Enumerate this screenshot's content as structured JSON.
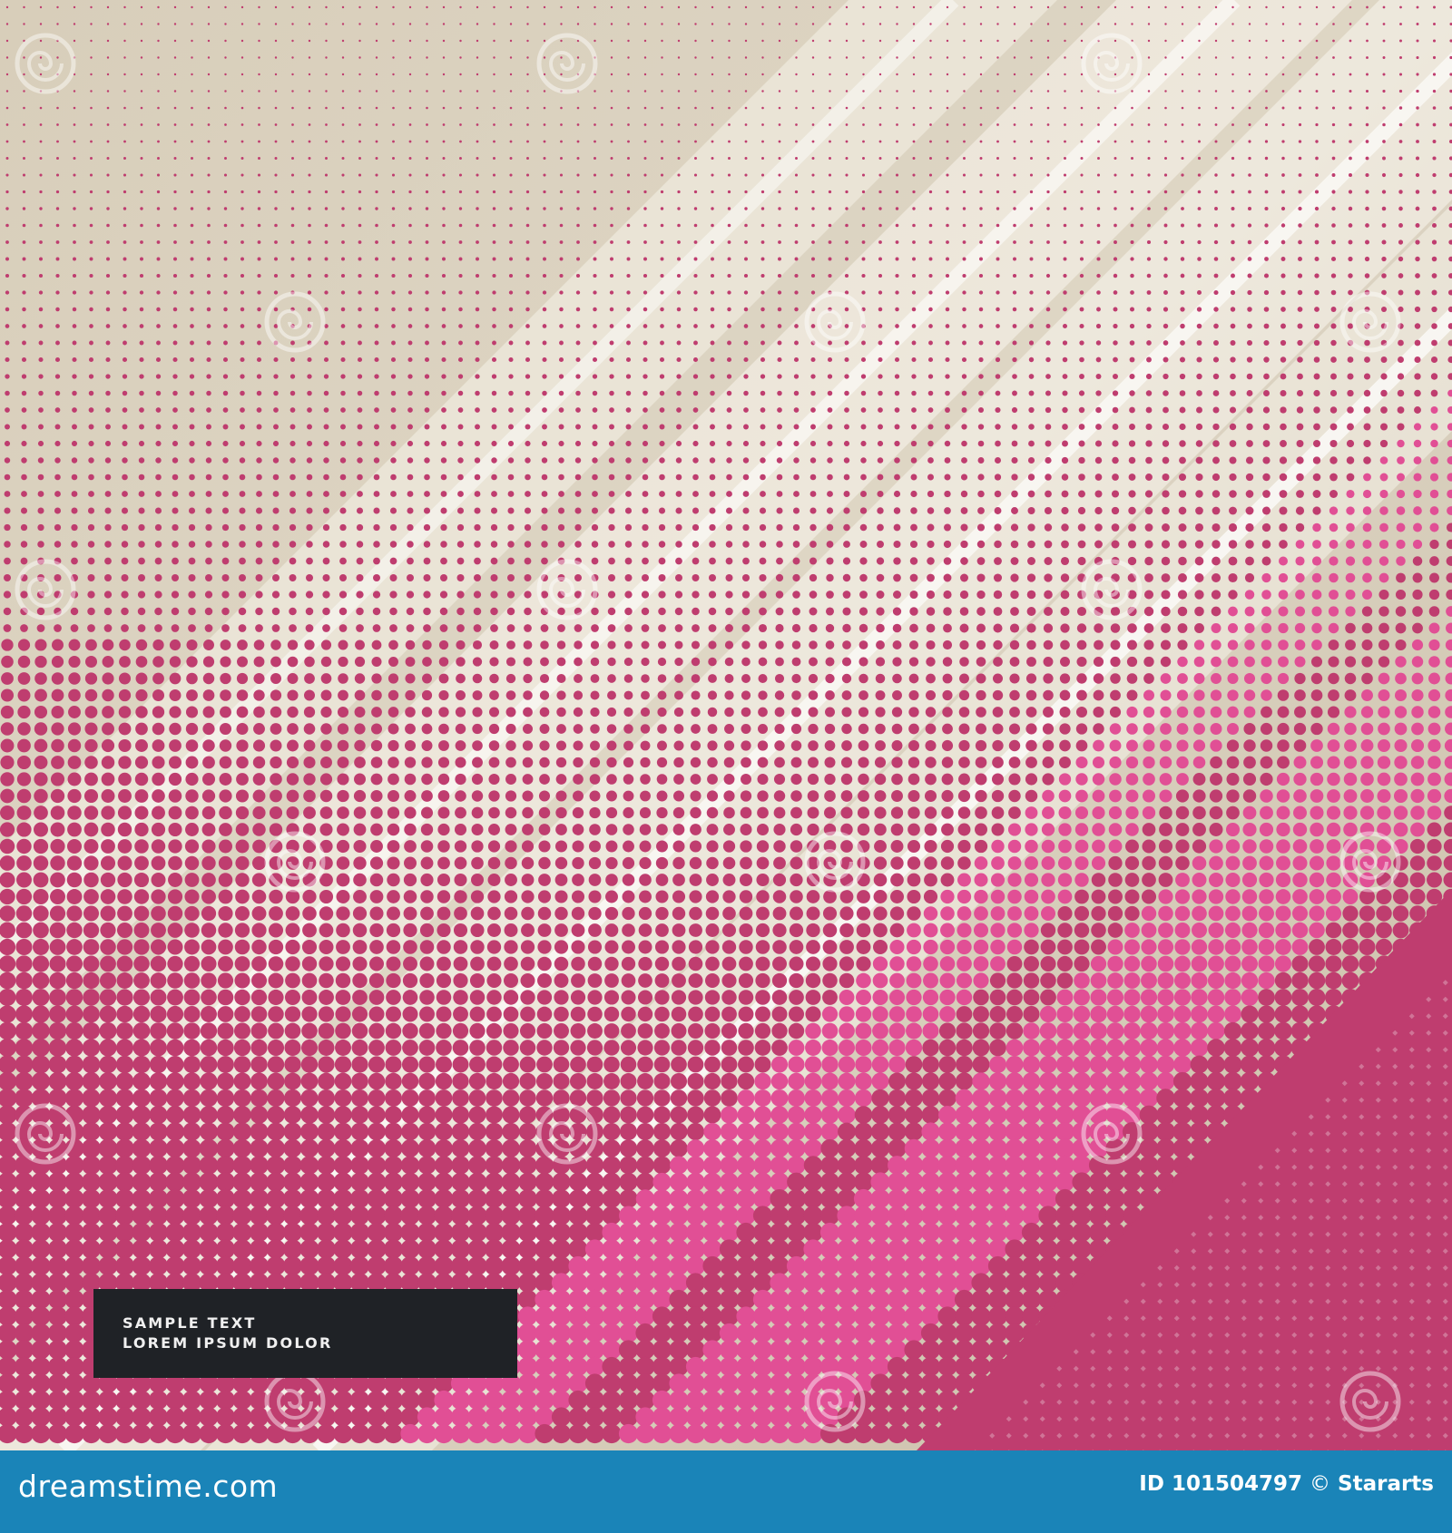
{
  "artwork": {
    "colors": {
      "background": "#d6ccb8",
      "dots": "#bf3d6f",
      "dots_highlight": "#e14f95",
      "highlight": "#f7f4ec",
      "text_box": "#1f2226",
      "footer": "#1a84b8"
    },
    "sample_text": {
      "line1": "SAMPLE TEXT",
      "line2": "LOREM IPSUM DOLOR"
    },
    "watermark_icon": "dreamstime-spiral-logo-icon",
    "watermark_text": "dreamstime"
  },
  "footer": {
    "brand": "dreamstime.com",
    "id_label": "ID",
    "id_value": "101504797",
    "copyright_symbol": "©",
    "author": "Stararts"
  }
}
